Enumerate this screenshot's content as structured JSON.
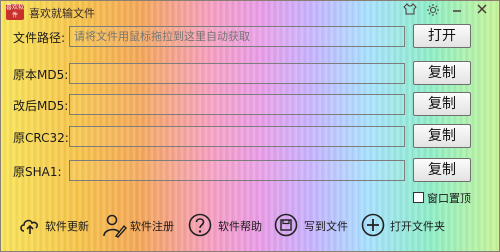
{
  "window": {
    "title": "喜欢就输文件",
    "logo_text": "喜欢软件",
    "title_icons": [
      "skin-icon",
      "settings-icon",
      "minimize-icon",
      "close-icon"
    ]
  },
  "rows": [
    {
      "label": "文件路径:",
      "value": "",
      "placeholder": "请将文件用鼠标拖拉到这里自动获取",
      "button": "打开"
    },
    {
      "label": "原本MD5:",
      "value": "",
      "placeholder": "",
      "button": "复制"
    },
    {
      "label": "改后MD5:",
      "value": "",
      "placeholder": "",
      "button": "复制"
    },
    {
      "label": "原CRC32:",
      "value": "",
      "placeholder": "",
      "button": "复制"
    },
    {
      "label": "原SHA1:",
      "value": "",
      "placeholder": "",
      "button": "复制"
    }
  ],
  "options": {
    "topmost_label": "窗口置顶",
    "topmost_checked": false
  },
  "toolbar": [
    {
      "label": "软件更新",
      "icon": "cloud-upload-icon"
    },
    {
      "label": "软件注册",
      "icon": "person-pen-icon"
    },
    {
      "label": "软件帮助",
      "icon": "question-icon"
    },
    {
      "label": "写到文件",
      "icon": "save-disk-icon"
    },
    {
      "label": "打开文件夹",
      "icon": "plus-circle-icon"
    }
  ]
}
